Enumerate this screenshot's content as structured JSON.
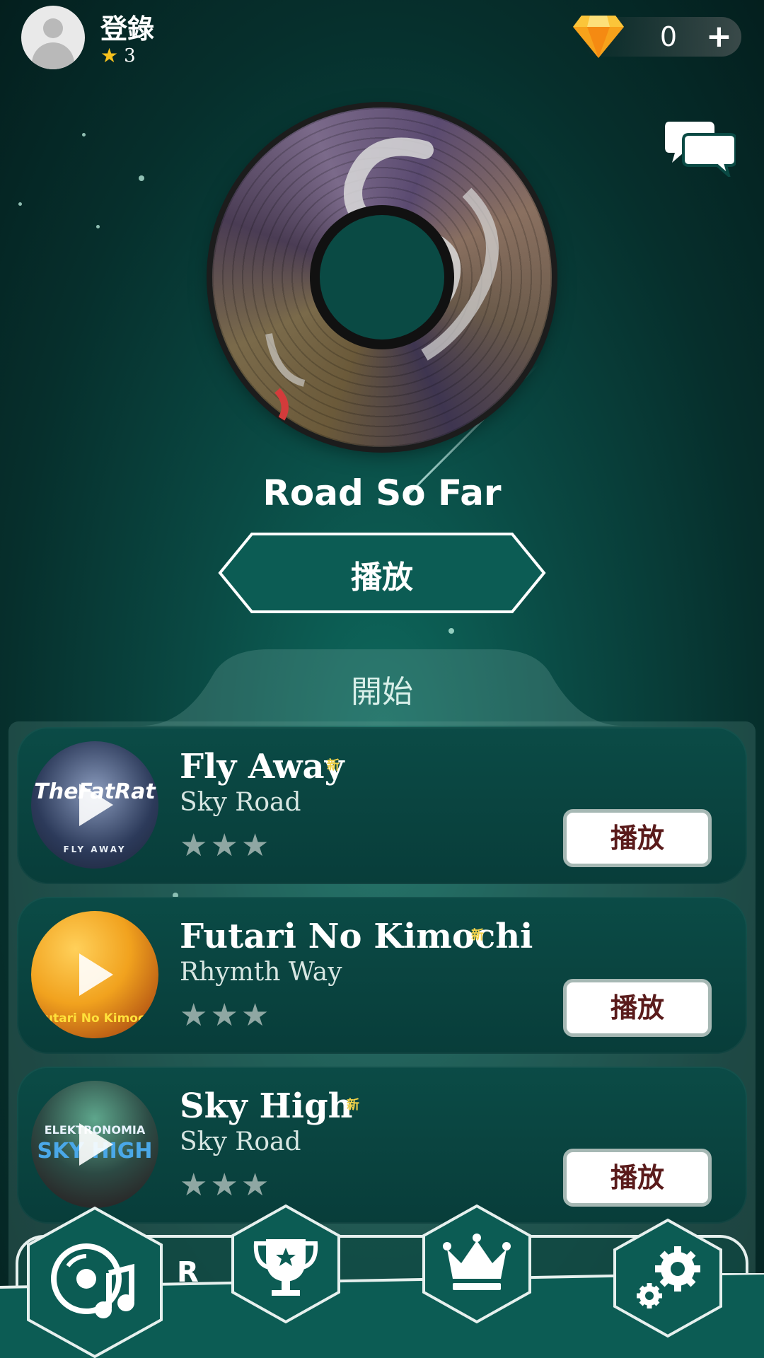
{
  "header": {
    "login_label": "登錄",
    "star_count": "3",
    "gem_value": "0",
    "gem_plus": "+"
  },
  "featured": {
    "title": "Road So Far",
    "play_label": "播放"
  },
  "start_tab_label": "開始",
  "songs": [
    {
      "title": "Fly Away",
      "new_badge": "新",
      "artist": "Sky Road",
      "stars": "★★★",
      "play_label": "播放",
      "cover_text": "TheFatRat",
      "cover_sub": "FLY AWAY"
    },
    {
      "title": "Futari No Kimochi",
      "new_badge": "新",
      "artist": "Rhymth Way",
      "stars": "★★★",
      "play_label": "播放",
      "cover_text": "utari No Kimoc"
    },
    {
      "title": "Sky High",
      "new_badge": "新",
      "artist": "Sky Road",
      "stars": "★★★",
      "play_label": "播放",
      "cover_text": "ELEKTRONOMIA",
      "cover_sub": "SKY HIGH"
    }
  ],
  "peek_song_initial": "R",
  "nav": {
    "items": [
      "music-disc-icon",
      "trophy-icon",
      "crown-icon",
      "settings-gear-icon"
    ]
  },
  "colors": {
    "background": "#0a4a44",
    "accent_gold": "#f6c21d",
    "play_text": "#5a1b1b"
  }
}
